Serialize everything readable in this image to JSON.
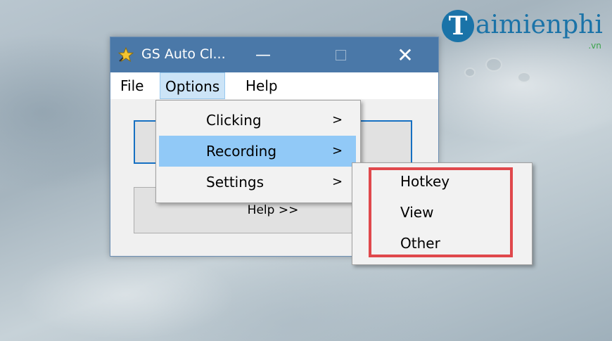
{
  "watermark": {
    "logo_letter": "T",
    "text": "aimienphi",
    "suffix": ".vn"
  },
  "window": {
    "title": "GS Auto Cl...",
    "icon": "star-app-icon",
    "controls": {
      "minimize": "—",
      "close": "✕"
    }
  },
  "menubar": {
    "file": "File",
    "options": "Options",
    "help": "Help"
  },
  "client": {
    "help_button": "Help >>"
  },
  "options_menu": {
    "items": [
      {
        "label": "Clicking",
        "arrow": ">"
      },
      {
        "label": "Recording",
        "arrow": ">"
      },
      {
        "label": "Settings",
        "arrow": ">"
      }
    ],
    "highlighted": "Recording"
  },
  "settings_submenu": {
    "items": [
      {
        "label": "Hotkey"
      },
      {
        "label": "View"
      },
      {
        "label": "Other"
      }
    ]
  },
  "colors": {
    "titlebar": "#4a78a8",
    "highlight": "#91c9f7",
    "annotation": "#e0484c"
  }
}
